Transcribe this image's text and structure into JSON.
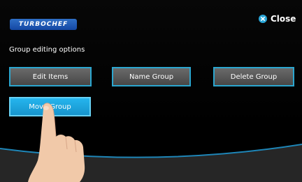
{
  "brand": {
    "logo_text": "TURBOCHEF",
    "logo_color": "#1f5bb8"
  },
  "header": {
    "close_label": "Close",
    "close_icon": "close-icon"
  },
  "main": {
    "heading": "Group editing options",
    "buttons": [
      {
        "label": "Edit Items",
        "state": "normal"
      },
      {
        "label": "Name Group",
        "state": "normal"
      },
      {
        "label": "Delete Group",
        "state": "normal"
      },
      {
        "label": "Move Group",
        "state": "pressed"
      }
    ]
  },
  "colors": {
    "accent": "#2ba6cf",
    "active": "#1fa6e0",
    "button_gray": "#5a5a5a",
    "background": "#000000"
  }
}
